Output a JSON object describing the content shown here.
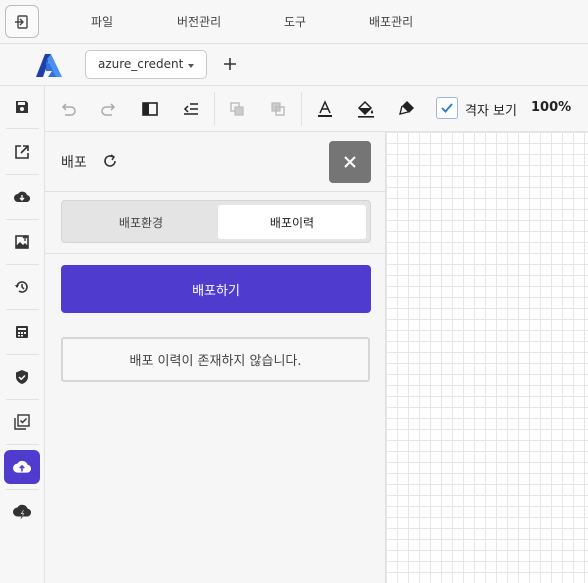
{
  "menubar": {
    "items": [
      "파일",
      "버전관리",
      "도구",
      "배포관리"
    ]
  },
  "file": {
    "name": "azure_credent",
    "add_label": "+"
  },
  "leftbar": {
    "icons": [
      "save-icon",
      "export-icon",
      "download-icon",
      "image-upload-icon",
      "history-icon",
      "calculator-icon",
      "shield-check-icon",
      "checklist-icon",
      "cloud-upload-icon",
      "cloud-bolt-icon"
    ],
    "active": "cloud-upload-icon"
  },
  "edit_toolbar": {
    "grid_label": "격자 보기",
    "grid_checked": true,
    "zoom": "100%"
  },
  "panel": {
    "title": "배포",
    "tabs": [
      {
        "label": "배포환경",
        "active": false
      },
      {
        "label": "배포이력",
        "active": true
      }
    ],
    "deploy_button": "배포하기",
    "empty_message": "배포 이력이 존재하지 않습니다."
  },
  "colors": {
    "accent": "#4f3ccf",
    "close_bg": "#757575",
    "azure_logo": "#2f6fe0"
  }
}
